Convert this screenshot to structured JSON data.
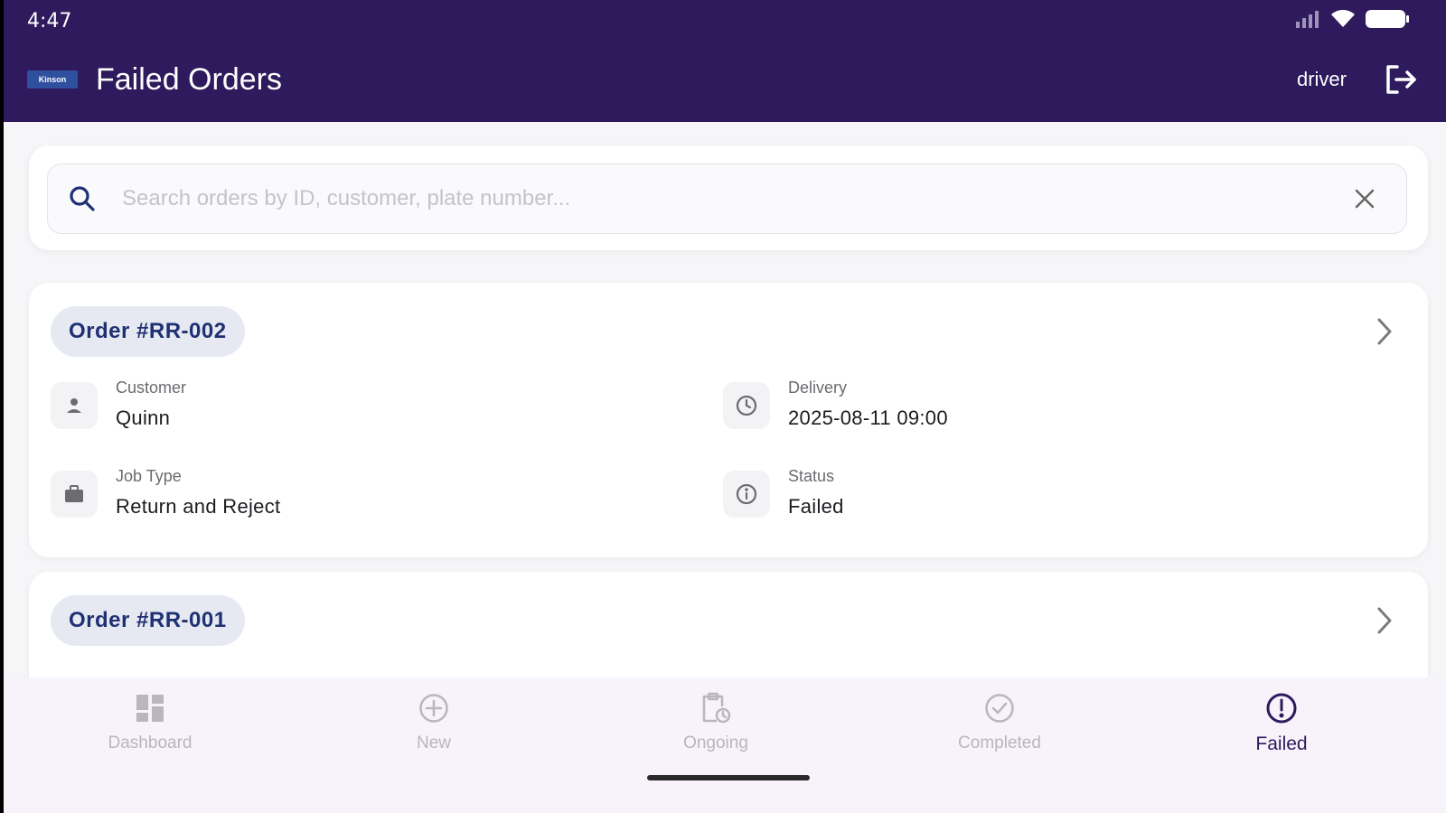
{
  "status_bar": {
    "time": "4:47"
  },
  "app_bar": {
    "logo_text": "Kinson",
    "title": "Failed Orders",
    "user": "driver"
  },
  "search": {
    "placeholder": "Search orders by ID, customer, plate number..."
  },
  "orders": [
    {
      "id": "Order #RR-002",
      "customer_label": "Customer",
      "customer": "Quinn",
      "delivery_label": "Delivery",
      "delivery": "2025-08-11 09:00",
      "job_type_label": "Job Type",
      "job_type": "Return and Reject",
      "status_label": "Status",
      "status": "Failed"
    },
    {
      "id": "Order #RR-001"
    }
  ],
  "nav": {
    "items": [
      {
        "label": "Dashboard",
        "icon": "dashboard-icon"
      },
      {
        "label": "New",
        "icon": "add-circle-icon"
      },
      {
        "label": "Ongoing",
        "icon": "clipboard-clock-icon"
      },
      {
        "label": "Completed",
        "icon": "check-circle-icon"
      },
      {
        "label": "Failed",
        "icon": "error-circle-icon"
      }
    ],
    "active": "Failed"
  },
  "colors": {
    "primary": "#2e1a5c",
    "chip_bg": "#e6e9f2",
    "chip_text": "#1f3173",
    "nav_bg": "#f8f2fa"
  }
}
